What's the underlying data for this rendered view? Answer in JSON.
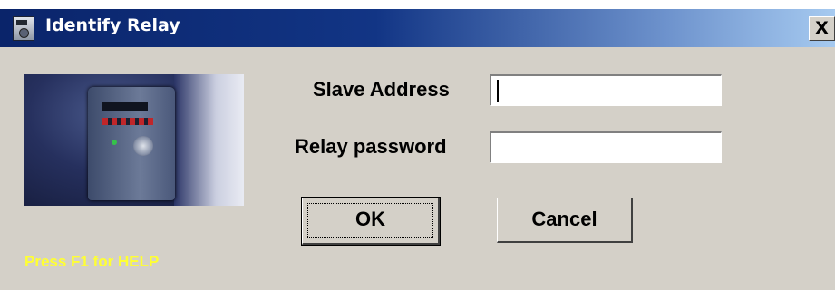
{
  "window": {
    "title": "Identify Relay",
    "close_label": "X",
    "title_icon": "relay-icon"
  },
  "form": {
    "slave_address_label": "Slave Address",
    "slave_address_value": "",
    "relay_password_label": "Relay password",
    "relay_password_value": ""
  },
  "buttons": {
    "ok_label": "OK",
    "cancel_label": "Cancel"
  },
  "help_text": "Press F1 for HELP",
  "colors": {
    "title_bar_start": "#0a246a",
    "title_bar_end": "#a6caf0",
    "dialog_background": "#d4d0c8",
    "help_text": "#ffff33"
  }
}
